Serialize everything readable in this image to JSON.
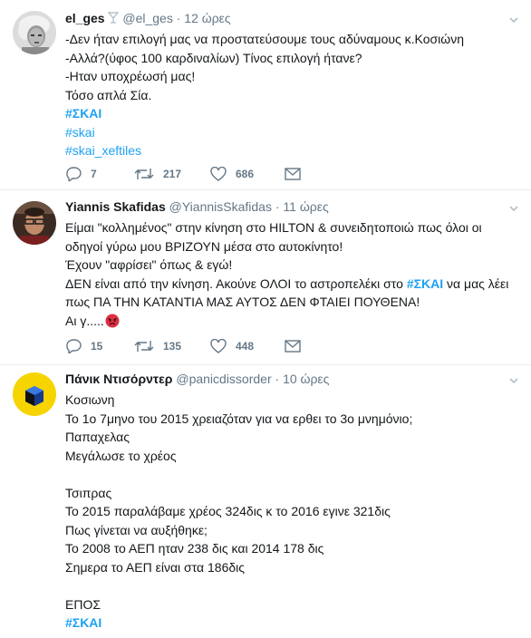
{
  "tweets": [
    {
      "name": "el_ges",
      "handle": "@el_ges",
      "dot": "·",
      "time": "12 ώρες",
      "lines": [
        {
          "text": "-Δεν ήταν επιλογή μας να προστατεύσουμε τους αδύναμους κ.Κοσιώνη"
        },
        {
          "text": "-Αλλά?(ύφος 100 καρδιναλίων) Τίνος επιλογή ήτανε?"
        },
        {
          "text": "-Ηταν υποχρέωσή μας!"
        },
        {
          "text": "Τόσο απλά Σία."
        }
      ],
      "hashtags": [
        "#ΣΚΑΙ",
        "#skai",
        "#skai_xeftiles"
      ],
      "replies": "7",
      "retweets": "217",
      "likes": "686"
    },
    {
      "name": "Yiannis Skafidas",
      "handle": "@YiannisSkafidas",
      "dot": "·",
      "time": "11 ώρες",
      "lines": [
        {
          "text": "Είμαι \"κολλημένος\" στην κίνηση στο HILTON & συνειδητοποιώ πως όλοι οι"
        },
        {
          "text": "οδηγοί γύρω μου ΒΡΙΖΟΥΝ μέσα στο αυτοκίνητο!"
        },
        {
          "text": "Έχουν \"αφρίσει\" όπως & εγώ!"
        },
        {
          "text": "ΔΕΝ είναι από την κίνηση. Ακούνε ΟΛΟΙ το αστροπελέκι στο ",
          "tag": "#ΣΚΑΙ",
          "after": " να μας λέει"
        },
        {
          "text": "πως ΠΑ ΤΗΝ ΚΑΤΑΝΤΙΑ ΜΑΣ ΑΥΤΟΣ ΔΕΝ ΦΤΑΙΕΙ ΠΟΥΘΕΝΑ!"
        },
        {
          "text": "Αι γ....."
        }
      ],
      "replies": "15",
      "retweets": "135",
      "likes": "448"
    },
    {
      "name": "Πάνικ Ντισόρντερ",
      "handle": "@panicdissorder",
      "dot": "·",
      "time": "10 ώρες",
      "lines": [
        {
          "text": "Κοσιωνη"
        },
        {
          "text": "Το 1ο 7μηνο του 2015 χρειαζόταν για να ερθει το 3ο μνημόνιο;"
        },
        {
          "text": "Παπαχελας"
        },
        {
          "text": "Μεγάλωσε το χρέος"
        },
        {
          "text": ""
        },
        {
          "text": "Τσιπρας"
        },
        {
          "text": "Το 2015 παραλάβαμε χρέος 324δις κ το 2016 εγινε 321δις"
        },
        {
          "text": "Πως γίνεται να αυξήθηκε;"
        },
        {
          "text": "Το 2008 το ΑΕΠ ηταν 238 δις και 2014 178 δις"
        },
        {
          "text": "Σημερα το ΑΕΠ είναι στα 186δις"
        },
        {
          "text": ""
        },
        {
          "text": "ΕΠΟΣ"
        }
      ],
      "hashtags": [
        "#ΣΚΑΙ"
      ]
    }
  ],
  "icons": {
    "badge": "cocktail-glass-icon",
    "reply": "reply-icon",
    "retweet": "retweet-icon",
    "like": "heart-icon",
    "dm": "envelope-icon",
    "more": "chevron-down-icon",
    "emoji": "angry-face-icon"
  },
  "colors": {
    "link": "#1da1f2",
    "muted": "#657786",
    "text": "#14171a",
    "divider": "#e6ecf0"
  }
}
